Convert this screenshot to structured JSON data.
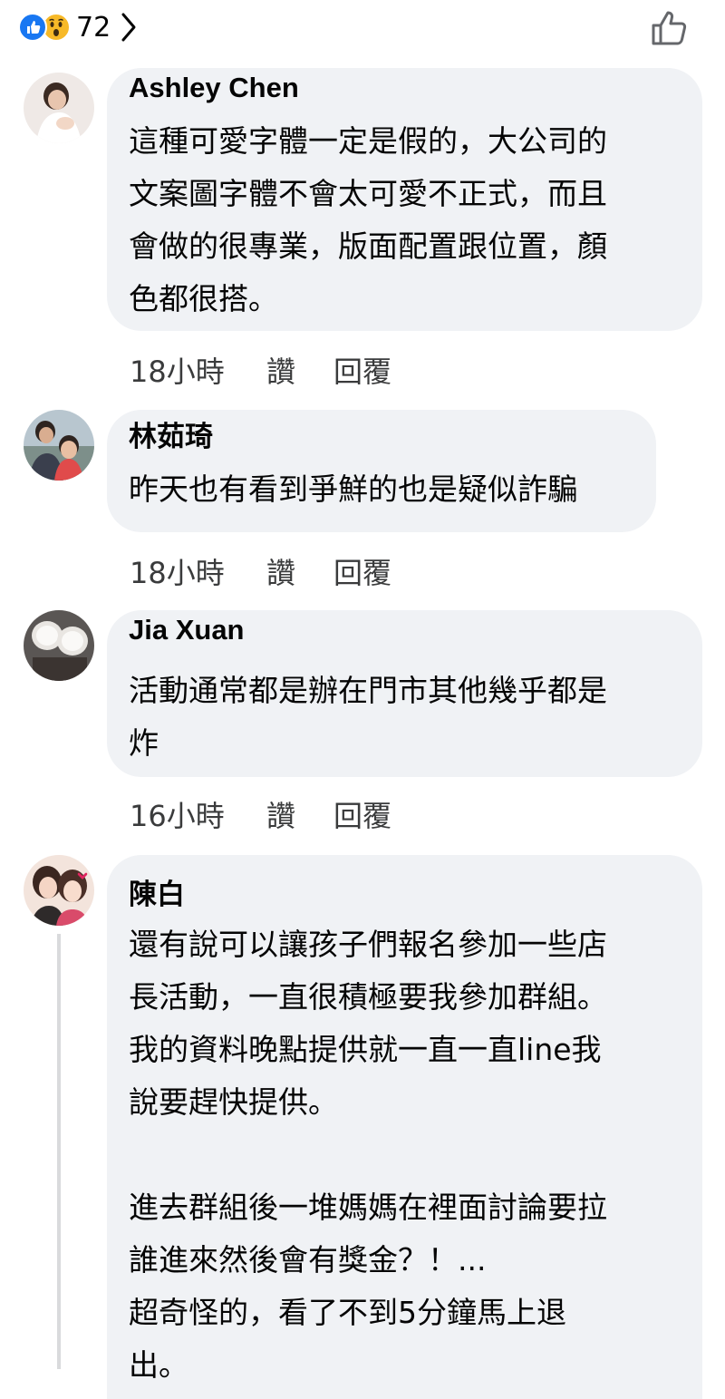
{
  "header": {
    "reaction_icons": [
      "like-icon",
      "wow-icon"
    ],
    "reaction_count": "72",
    "like_icon": "thumbs-up-outline-icon"
  },
  "comments": [
    {
      "name": "Ashley Chen",
      "text": "這種可愛字體一定是假的，大公司的\n文案圖字體不會太可愛不正式，而且\n會做的很專業，版面配置跟位置，顏\n色都很搭。",
      "time": "18小時",
      "like": "讚",
      "reply": "回覆"
    },
    {
      "name": "林茹琦",
      "text": "昨天也有看到爭鮮的也是疑似詐騙",
      "time": "18小時",
      "like": "讚",
      "reply": "回覆"
    },
    {
      "name": "Jia Xuan",
      "text": "活動通常都是辦在門市其他幾乎都是\n炸",
      "time": "16小時",
      "like": "讚",
      "reply": "回覆"
    },
    {
      "name": "陳白",
      "text": "還有說可以讓孩子們報名參加一些店\n長活動，一直很積極要我參加群組。\n我的資料晚點提供就一直一直line我\n說要趕快提供。\n\n進去群組後一堆媽媽在裡面討論要拉\n誰進來然後會有獎金？！...\n超奇怪的，看了不到5分鐘馬上退\n出。"
    }
  ],
  "colors": {
    "bubble": "#f0f2f5",
    "like_blue": "#1877f2",
    "wow_yellow": "#f7b928",
    "meta_text": "#3a3b3c"
  }
}
